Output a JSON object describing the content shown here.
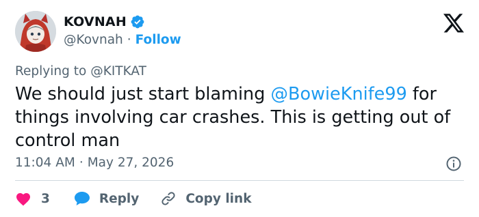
{
  "author": {
    "display_name": "KOVNAH",
    "handle": "@Kovnah",
    "separator": "·",
    "follow_label": "Follow",
    "verified": true
  },
  "reply_context": {
    "prefix": "Replying to",
    "target": "@KITKAT"
  },
  "tweet": {
    "text_before": "We should just start blaming ",
    "mention": "@BowieKnife99",
    "text_after": " for things involving car crashes. This is getting out of control man"
  },
  "meta": {
    "time": "11:04 AM",
    "separator": "·",
    "date": "May 27, 2026"
  },
  "actions": {
    "like_count": "3",
    "reply_label": "Reply",
    "copy_label": "Copy link"
  },
  "icons": {
    "verified": "verified-badge-icon",
    "brand": "x-logo-icon",
    "info": "info-icon",
    "like": "heart-icon",
    "reply": "speech-bubble-icon",
    "copy": "link-icon"
  },
  "colors": {
    "accent": "#1d9bf0",
    "text": "#0f1419",
    "muted": "#536471",
    "like": "#f91880",
    "divider": "#cfd9de"
  }
}
